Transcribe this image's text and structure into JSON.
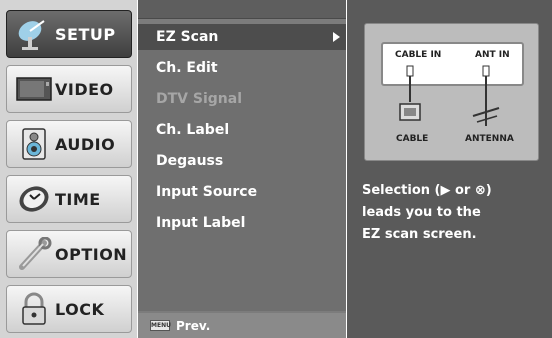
{
  "sidebar": {
    "categories": [
      {
        "label": "SETUP",
        "icon": "satellite-dish-icon",
        "active": true
      },
      {
        "label": "VIDEO",
        "icon": "tv-screen-icon",
        "active": false
      },
      {
        "label": "AUDIO",
        "icon": "speaker-icon",
        "active": false
      },
      {
        "label": "TIME",
        "icon": "clock-icon",
        "active": false
      },
      {
        "label": "OPTION",
        "icon": "wrench-icon",
        "active": false
      },
      {
        "label": "LOCK",
        "icon": "padlock-icon",
        "active": false
      }
    ]
  },
  "menu": {
    "items": [
      {
        "label": "EZ Scan",
        "selected": true,
        "disabled": false
      },
      {
        "label": "Ch. Edit",
        "selected": false,
        "disabled": false
      },
      {
        "label": "DTV Signal",
        "selected": false,
        "disabled": true
      },
      {
        "label": "Ch. Label",
        "selected": false,
        "disabled": false
      },
      {
        "label": "Degauss",
        "selected": false,
        "disabled": false
      },
      {
        "label": "Input Source",
        "selected": false,
        "disabled": false
      },
      {
        "label": "Input Label",
        "selected": false,
        "disabled": false
      }
    ],
    "footer_button": "MENU",
    "footer_label": "Prev."
  },
  "info": {
    "diagram": {
      "port_cable": "CABLE IN",
      "port_antenna": "ANT IN",
      "device_cable": "CABLE",
      "device_antenna": "ANTENNA"
    },
    "description_lines": [
      "Selection (▶ or ⊗)",
      "leads you to the",
      "EZ scan screen."
    ]
  },
  "colors": {
    "sidebar_bg": "#d4d4d4",
    "menu_bg": "#6f6f6f",
    "selected_bg": "#4d4d4d",
    "info_bg": "#5a5a5a",
    "text": "#ffffff",
    "disabled_text": "#a6a6a6"
  }
}
